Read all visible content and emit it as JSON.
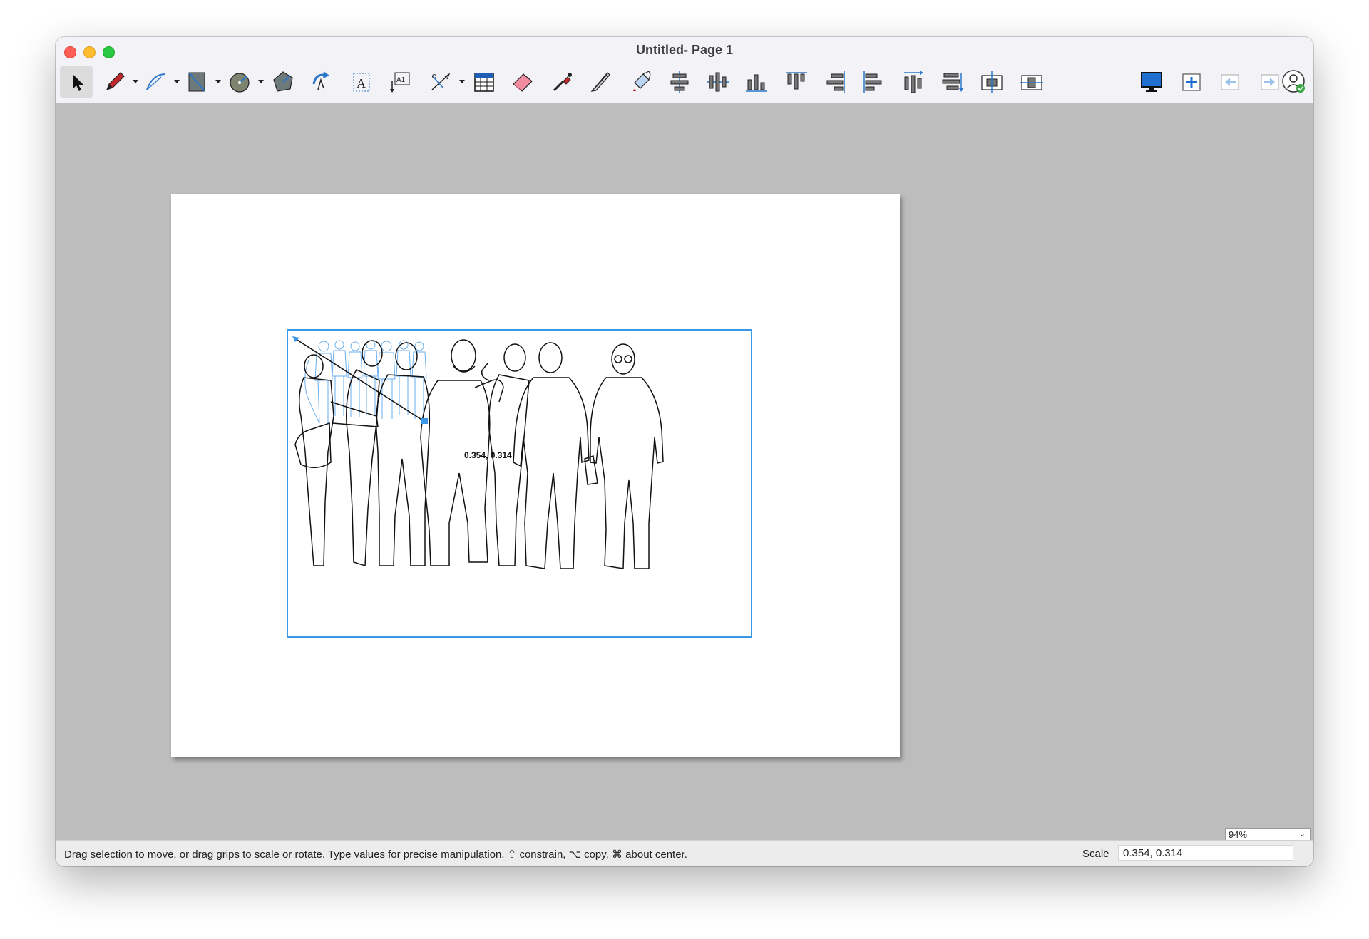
{
  "window": {
    "title": "Untitled- Page 1"
  },
  "toolbar": {
    "tools": [
      {
        "name": "select-tool",
        "icon": "arrow-pointer-icon"
      },
      {
        "name": "pencil-tool",
        "icon": "pencil-icon",
        "menu": true
      },
      {
        "name": "bezier-tool",
        "icon": "bezier-curve-icon",
        "menu": true
      },
      {
        "name": "shape-tool",
        "icon": "rectangle-shape-icon",
        "menu": true
      },
      {
        "name": "circle-tool",
        "icon": "circle-radius-icon",
        "menu": true
      },
      {
        "name": "polygon-tool",
        "icon": "polygon-icon"
      },
      {
        "name": "rotate-tool",
        "icon": "rotate-arrow-icon"
      },
      {
        "name": "text-tool",
        "icon": "text-box-icon"
      },
      {
        "name": "text-on-path-tool",
        "icon": "text-label-icon"
      },
      {
        "name": "dimension-tool",
        "icon": "dimension-icon",
        "menu": true
      },
      {
        "name": "table-tool",
        "icon": "table-grid-icon"
      },
      {
        "name": "eraser-tool",
        "icon": "eraser-icon"
      },
      {
        "name": "eyedropper-tool",
        "icon": "eyedropper-icon"
      },
      {
        "name": "knife-tool",
        "icon": "knife-icon"
      },
      {
        "name": "paint-bucket-tool",
        "icon": "paint-bucket-icon"
      }
    ],
    "align_tools": [
      {
        "name": "align-center-horizontal",
        "icon": "align-center-h-icon"
      },
      {
        "name": "align-center-vertical",
        "icon": "align-center-v-icon"
      },
      {
        "name": "align-bottom",
        "icon": "align-bottom-icon"
      },
      {
        "name": "align-top",
        "icon": "align-top-icon"
      },
      {
        "name": "align-right",
        "icon": "align-right-icon"
      },
      {
        "name": "align-left",
        "icon": "align-left-icon"
      },
      {
        "name": "distribute-horizontal",
        "icon": "distribute-h-icon"
      },
      {
        "name": "distribute-vertical",
        "icon": "distribute-v-icon"
      },
      {
        "name": "center-on-page-h",
        "icon": "center-page-h-icon"
      },
      {
        "name": "center-on-page-v",
        "icon": "center-page-v-icon"
      }
    ],
    "right_tools": [
      {
        "name": "present-button",
        "icon": "monitor-icon"
      },
      {
        "name": "add-page-button",
        "icon": "add-page-icon"
      },
      {
        "name": "previous-page-button",
        "icon": "previous-page-icon"
      },
      {
        "name": "next-page-button",
        "icon": "next-page-icon"
      },
      {
        "name": "account-button",
        "icon": "user-check-icon"
      }
    ]
  },
  "canvas": {
    "selection_coords": "0.354, 0.314",
    "accent_color": "#3a98e6"
  },
  "zoom": {
    "value": "94%"
  },
  "statusbar": {
    "hint": "Drag selection to move, or drag grips to scale or rotate. Type values for precise manipulation. ⇧ constrain, ⌥ copy, ⌘ about center.",
    "scale_label": "Scale",
    "scale_value": "0.354, 0.314"
  }
}
